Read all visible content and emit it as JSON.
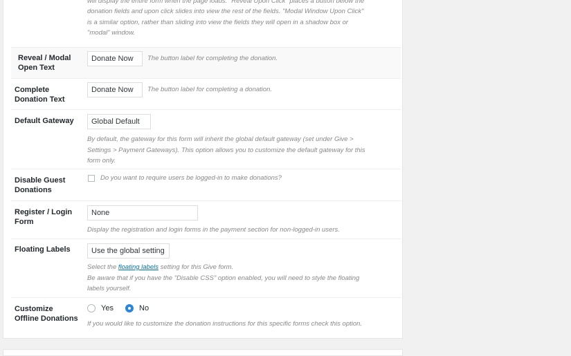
{
  "top_desc": {
    "lines": [
      "will display the entire form when the page loads. \"Reveal Upon Click\" places a button below the",
      "donation fields and upon click slides into view the rest of the fields. \"Modal Window Upon Click\"",
      "is a similar option, rather than sliding into view the fields they will open in a shadow box or",
      "\"modal\" window."
    ]
  },
  "reveal_modal": {
    "label_1": "Reveal / Modal",
    "label_2": "Open Text",
    "value": "Donate Now",
    "desc": "The button label for completing the donation."
  },
  "complete_donation": {
    "label_1": "Complete",
    "label_2": "Donation Text",
    "value": "Donate Now",
    "desc": "The button label for completing a donation."
  },
  "default_gateway": {
    "label": "Default Gateway",
    "value": "Global Default",
    "desc_lines": [
      "By default, the gateway for this form will inherit the global default gateway (set under Give >",
      "Settings > Payment Gateways). This option allows you to customize the default gateway for this",
      "form only."
    ]
  },
  "disable_guest": {
    "label_1": "Disable Guest",
    "label_2": "Donations",
    "checked": false,
    "desc": "Do you want to require users be logged-in to make donations?"
  },
  "register_login": {
    "label_1": "Register / Login",
    "label_2": "Form",
    "value": "None",
    "desc": "Display the registration and login forms in the payment section for non-logged-in users."
  },
  "floating_labels": {
    "label": "Floating Labels",
    "value": "Use the global setting",
    "desc_pre": "Select the ",
    "desc_link": "floating labels",
    "desc_post": " setting for this Give form.",
    "desc_line2": "Be aware that if you have the \"Disable CSS\" option enabled, you will need to style the floating",
    "desc_line3": "labels yourself."
  },
  "offline_donations": {
    "label_1": "Customize",
    "label_2": "Offline Donations",
    "options": [
      "Yes",
      "No"
    ],
    "selected": "No",
    "desc": "If you would like to customize the donation instructions for this specific forms check this option."
  },
  "colors": {
    "accent": "#2b86d9",
    "link": "#0073aa",
    "desc_text": "#888888"
  }
}
